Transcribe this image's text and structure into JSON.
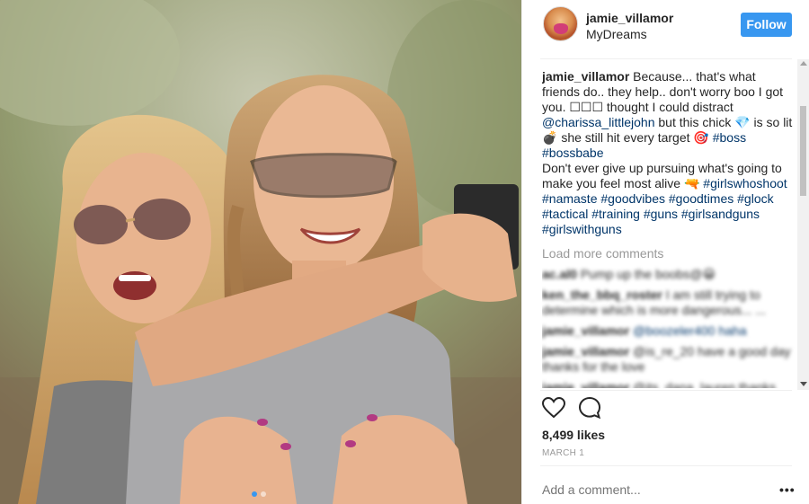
{
  "post": {
    "username": "jamie_villamor",
    "location": "MyDreams",
    "follow_label": "Follow",
    "caption": {
      "username": "jamie_villamor",
      "text1": "Because... that's what friends do.. they help.. don't worry boo I got you. ☐☐☐ thought I could distract ",
      "mention": "@charissa_littlejohn",
      "text2": " but this chick 💎 is so lit 💣 she still hit every target 🎯 ",
      "tags1": "#boss #bossbabe",
      "text3": "Don't ever give up pursuing what's going to make you feel most alive 🔫 ",
      "tags2": "#girlswhoshoot #namaste #goodvibes #goodtimes #glock #tactical #training #guns #girlsandguns #girlswithguns"
    },
    "load_more": "Load more comments",
    "comments": [
      {
        "username": "ac.al0",
        "text": "Pump up the boobs@😀"
      },
      {
        "username": "ken_the_bbq_roster",
        "text": "I am still trying to determine which is more dangerous... ..."
      },
      {
        "username": "jamie_villamor",
        "text": "@boozeler400 haha"
      },
      {
        "username": "jamie_villamor",
        "text": "@is_re_20 have a good day thanks for the love"
      },
      {
        "username": "jamie_villamor",
        "text": "@its_dana_lauren thanks"
      }
    ],
    "likes": "8,499 likes",
    "date": "MARCH 1",
    "add_comment_placeholder": "Add a comment...",
    "more_label": "•••"
  },
  "icons": {
    "like": "heart-icon",
    "comment": "comment-icon",
    "options": "more-options-icon"
  },
  "colors": {
    "accent": "#3897f0",
    "link": "#003569",
    "muted": "#999999"
  },
  "carousel": {
    "slides": 2,
    "active": 1
  }
}
